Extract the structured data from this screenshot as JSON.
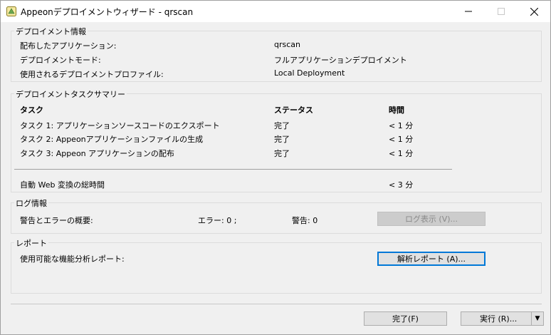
{
  "window": {
    "title": "Appeonデプロイメントウィザード - qrscan"
  },
  "deployment_info": {
    "title": "デプロイメント情報",
    "rows": [
      {
        "label": "配布したアプリケーション:",
        "value": "qrscan"
      },
      {
        "label": "デプロイメントモード:",
        "value": "フルアプリケーションデプロイメント"
      },
      {
        "label": "使用されるデプロイメントプロファイル:",
        "value": "Local Deployment"
      }
    ]
  },
  "task_summary": {
    "title": "デプロイメントタスクサマリー",
    "headers": {
      "task": "タスク",
      "status": "ステータス",
      "time": "時間"
    },
    "rows": [
      {
        "task": "タスク 1: アプリケーションソースコードのエクスポート",
        "status": "完了",
        "time": "< 1 分"
      },
      {
        "task": "タスク 2: Appeonアプリケーションファイルの生成",
        "status": "完了",
        "time": "< 1 分"
      },
      {
        "task": "タスク 3: Appeon アプリケーションの配布",
        "status": "完了",
        "time": "< 1 分"
      }
    ],
    "total_label": "自動 Web 変換の総時間",
    "total_value": "< 3 分"
  },
  "log": {
    "title": "ログ情報",
    "summary_label": "警告とエラーの概要:",
    "errors": "エラー: 0 ;",
    "warnings": "警告: 0",
    "view_button": "ログ表示 (V)..."
  },
  "report": {
    "title": "レポート",
    "label": "使用可能な機能分析レポート:",
    "button": "解析レポート (A)..."
  },
  "footer": {
    "finish_button": "完了(F)",
    "run_button": "実行 (R)..."
  },
  "colors": {
    "accent": "#0078d7",
    "border": "#dcdcdc",
    "background": "#f0f0f0"
  }
}
